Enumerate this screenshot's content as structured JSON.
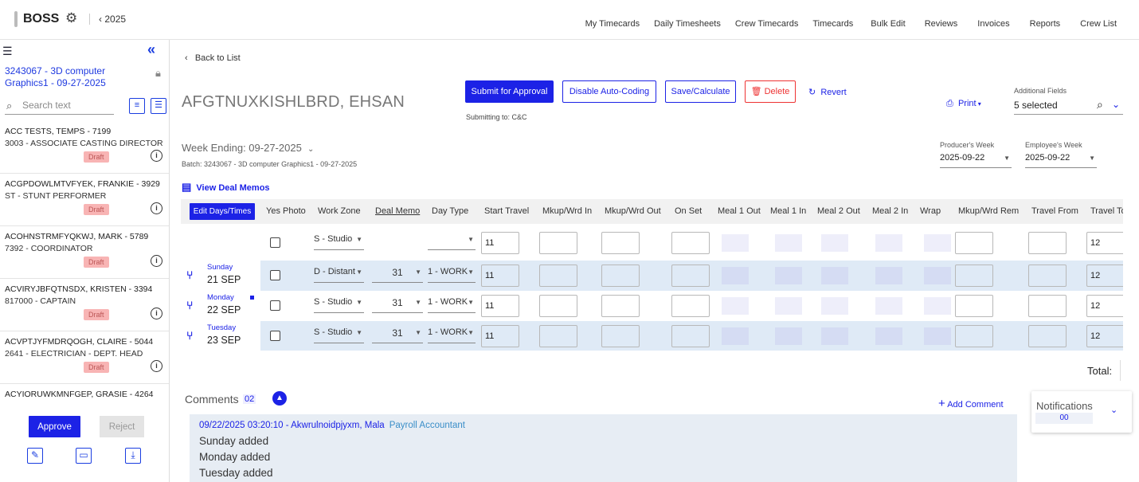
{
  "header": {
    "brand": "BOSS",
    "year": "2025",
    "nav": [
      "My Timecards",
      "Daily Timesheets",
      "Crew Timecards",
      "Timecards",
      "Bulk Edit",
      "Reviews",
      "Invoices",
      "Reports",
      "Crew List"
    ]
  },
  "sidebar": {
    "batch": "3243067 - 3D computer Graphics1 - 09-27-2025",
    "search_placeholder": "Search text",
    "employees": [
      {
        "name": "ACC TESTS, TEMPS - 7199",
        "role": "3003 - ASSOCIATE CASTING DIRECTOR",
        "status": "Draft"
      },
      {
        "name": "ACGPDOWLMTVFYEK, FRANKIE - 3929",
        "role": "ST - STUNT PERFORMER",
        "status": "Draft"
      },
      {
        "name": "ACOHNSTRMFYQKWJ, MARK - 5789",
        "role": "7392 - COORDINATOR",
        "status": "Draft"
      },
      {
        "name": "ACVIRYJBFQTNSDX, KRISTEN - 3394",
        "role": "817000 - CAPTAIN",
        "status": "Draft"
      },
      {
        "name": "ACVPTJYFMDRQOGH, CLAIRE - 5044",
        "role": "2641 - ELECTRICIAN - DEPT. HEAD",
        "status": "Draft"
      },
      {
        "name": "ACYIORUWKMNFGEP, GRASIE - 4264",
        "role": "",
        "status": ""
      }
    ],
    "approve_label": "Approve",
    "reject_label": "Reject"
  },
  "main": {
    "back_label": "Back to List",
    "employee_name": "AFGTNUXKISHLBRD, EHSAN",
    "submit_label": "Submit for Approval",
    "disable_label": "Disable Auto-Coding",
    "save_label": "Save/Calculate",
    "delete_label": "Delete",
    "revert_label": "Revert",
    "submitting_to": "Submitting to: C&C",
    "print_label": "Print",
    "additional_fields_label": "Additional Fields",
    "additional_fields_value": "5 selected",
    "week_ending": "Week Ending: 09-27-2025",
    "batch_line": "Batch: 3243067 - 3D computer Graphics1 - 09-27-2025",
    "producers_week_label": "Producer's Week",
    "producers_week_value": "2025-09-22",
    "employees_week_label": "Employee's Week",
    "employees_week_value": "2025-09-22",
    "deal_memos_label": "View Deal Memos"
  },
  "grid": {
    "edit_days_label": "Edit Days/Times",
    "columns": [
      "Yes Photo",
      "Work Zone",
      "Deal Memo",
      "Day Type",
      "Start Travel",
      "Mkup/Wrd In",
      "Mkup/Wrd Out",
      "On Set",
      "Meal 1 Out",
      "Meal 1 In",
      "Meal 2 Out",
      "Meal 2 In",
      "Wrap",
      "Mkup/Wrd Rem",
      "Travel From",
      "Travel To"
    ],
    "bulk_row": {
      "work_zone": "S - Studio",
      "deal_memo": "",
      "day_type": "",
      "start_travel": "11",
      "travel_to": "12"
    },
    "rows": [
      {
        "day": "Sunday",
        "date": "21 SEP",
        "work_zone": "D - Distant",
        "deal_memo": "31",
        "day_type": "1 - WORK",
        "start_travel": "11",
        "travel_to": "12"
      },
      {
        "day": "Monday",
        "date": "22 SEP",
        "work_zone": "S - Studio",
        "deal_memo": "31",
        "day_type": "1 - WORK",
        "start_travel": "11",
        "travel_to": "12"
      },
      {
        "day": "Tuesday",
        "date": "23 SEP",
        "work_zone": "S - Studio",
        "deal_memo": "31",
        "day_type": "1 - WORK",
        "start_travel": "11",
        "travel_to": "12"
      }
    ],
    "total_label": "Total:"
  },
  "comments": {
    "title": "Comments",
    "count": "02",
    "add_label": "Add Comment",
    "entry": {
      "meta": "09/22/2025 03:20:10 - Akwrulnoidpjyxm, Mala",
      "role": "Payroll Accountant",
      "lines": [
        "Sunday added",
        "Monday added",
        "Tuesday added"
      ]
    }
  },
  "notifications": {
    "title": "Notifications",
    "count": "00"
  },
  "colors": {
    "accent": "#1c22e6",
    "draft": "#f8b4b4",
    "row_alt": "#dfeaf6",
    "delete": "#ee3333"
  }
}
